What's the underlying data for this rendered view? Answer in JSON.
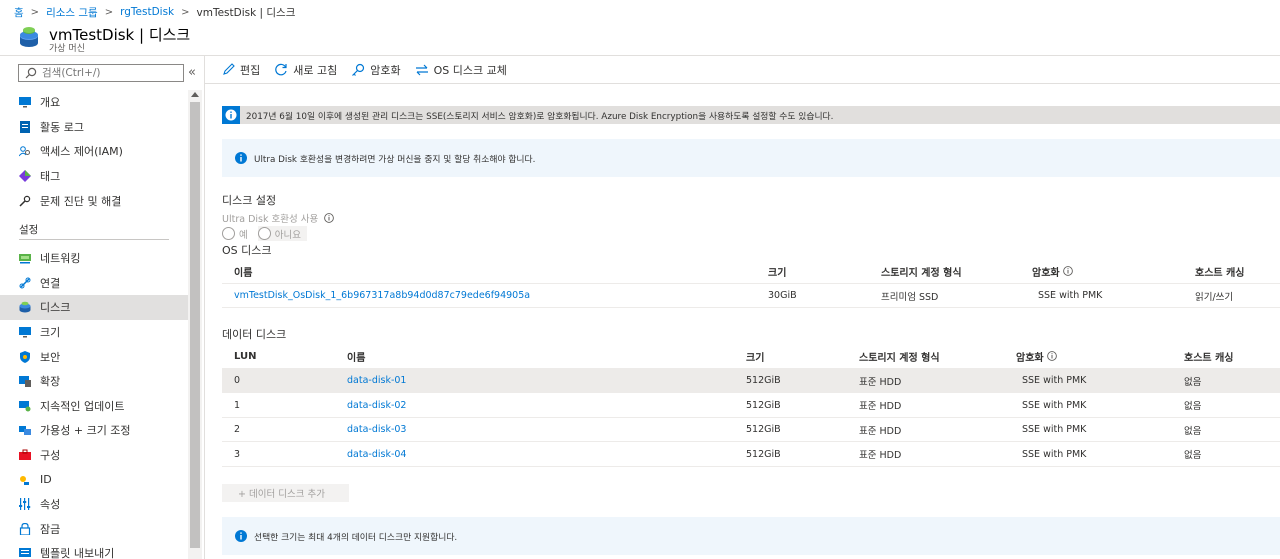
{
  "breadcrumb": {
    "items": [
      "홈",
      "리소스 그룹",
      "rgTestDisk"
    ],
    "current": "vmTestDisk | 디스크"
  },
  "header": {
    "title": "vmTestDisk | 디스크",
    "subtitle": "가상 머신"
  },
  "sidebar": {
    "search_placeholder": "검색(Ctrl+/)",
    "collapse_icon": "«",
    "items_top": [
      {
        "label": "개요",
        "icon": "monitor-icon"
      },
      {
        "label": "활동 로그",
        "icon": "activity-log-icon"
      },
      {
        "label": "액세스 제어(IAM)",
        "icon": "iam-icon"
      },
      {
        "label": "태그",
        "icon": "tag-icon"
      },
      {
        "label": "문제 진단 및 해결",
        "icon": "wrench-icon"
      }
    ],
    "section_settings": "설정",
    "items_settings": [
      {
        "label": "네트워킹",
        "icon": "networking-icon"
      },
      {
        "label": "연결",
        "icon": "connect-icon"
      },
      {
        "label": "디스크",
        "icon": "disk-icon",
        "active": true
      },
      {
        "label": "크기",
        "icon": "size-icon"
      },
      {
        "label": "보안",
        "icon": "shield-icon"
      },
      {
        "label": "확장",
        "icon": "extensions-icon"
      },
      {
        "label": "지속적인 업데이트",
        "icon": "continuous-update-icon"
      },
      {
        "label": "가용성 + 크기 조정",
        "icon": "availability-icon"
      },
      {
        "label": "구성",
        "icon": "configuration-icon"
      },
      {
        "label": "ID",
        "icon": "identity-icon"
      },
      {
        "label": "속성",
        "icon": "properties-icon"
      },
      {
        "label": "잠금",
        "icon": "lock-icon"
      },
      {
        "label": "템플릿 내보내기",
        "icon": "export-template-icon"
      }
    ]
  },
  "toolbar": {
    "edit": "편집",
    "refresh": "새로 고침",
    "encrypt": "암호화",
    "swap_os": "OS 디스크 교체"
  },
  "banners": {
    "sse": "2017년 6월 10일 이후에 생성된 관리 디스크는 SSE(스토리지 서비스 암호화)로 암호화됩니다. Azure Disk Encryption을 사용하도록 설정할 수도 있습니다.",
    "ultra": "Ultra Disk 호환성을 변경하려면 가상 머신을 중지 및 할당 취소해야 합니다.",
    "max_disks": "선택한 크기는 최대 4개의 데이터 디스크만 지원합니다."
  },
  "disk_settings": {
    "heading": "디스크 설정",
    "ultra_label": "Ultra Disk 호환성 사용",
    "yes": "예",
    "no": "아니요"
  },
  "os_disk": {
    "heading": "OS 디스크",
    "columns": [
      "이름",
      "크기",
      "스토리지 계정 형식",
      "암호화",
      "호스트 캐싱"
    ],
    "row": {
      "name": "vmTestDisk_OsDisk_1_6b967317a8b94d0d87c79ede6f94905a",
      "size": "30GiB",
      "type": "프리미엄 SSD",
      "encryption": "SSE with PMK",
      "caching": "읽기/쓰기"
    }
  },
  "data_disks": {
    "heading": "데이터 디스크",
    "columns": [
      "LUN",
      "이름",
      "크기",
      "스토리지 계정 형식",
      "암호화",
      "호스트 캐싱"
    ],
    "rows": [
      {
        "lun": "0",
        "name": "data-disk-01",
        "size": "512GiB",
        "type": "표준 HDD",
        "encryption": "SSE with PMK",
        "caching": "없음"
      },
      {
        "lun": "1",
        "name": "data-disk-02",
        "size": "512GiB",
        "type": "표준 HDD",
        "encryption": "SSE with PMK",
        "caching": "없음"
      },
      {
        "lun": "2",
        "name": "data-disk-03",
        "size": "512GiB",
        "type": "표준 HDD",
        "encryption": "SSE with PMK",
        "caching": "없음"
      },
      {
        "lun": "3",
        "name": "data-disk-04",
        "size": "512GiB",
        "type": "표준 HDD",
        "encryption": "SSE with PMK",
        "caching": "없음"
      }
    ],
    "add_button": "+ 데이터 디스크 추가"
  },
  "colors": {
    "accent": "#0078d4",
    "selected_bg": "#e1e0df",
    "info_bg": "#eff6fc"
  }
}
